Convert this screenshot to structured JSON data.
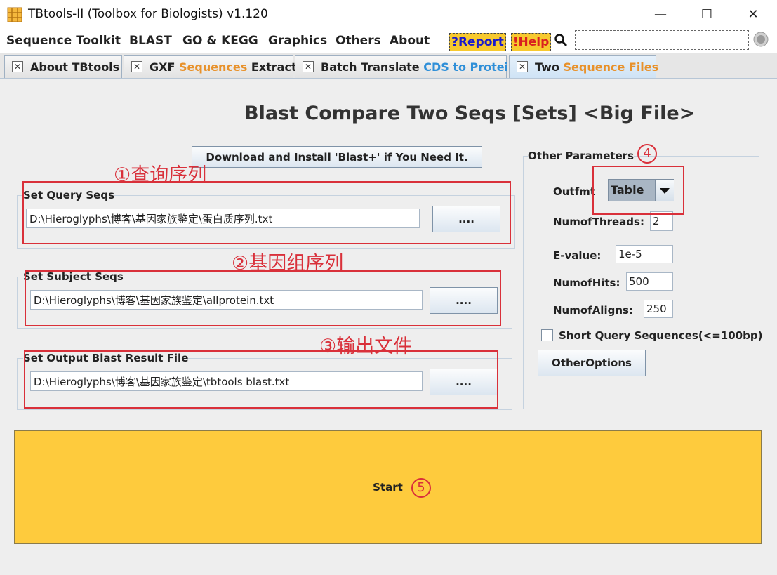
{
  "window": {
    "title": "TBtools-II (Toolbox for Biologists) v1.120",
    "minimize": "—",
    "maximize": "☐",
    "close": "✕"
  },
  "menu": {
    "items": [
      "Sequence Toolkit",
      "BLAST",
      "GO & KEGG",
      "Graphics",
      "Others",
      "About"
    ],
    "report": "?Report",
    "help": "!Help",
    "search_value": ""
  },
  "tabs": [
    {
      "label": "About TBtools"
    },
    {
      "label_parts": [
        "GXF",
        "Sequences",
        "Extract"
      ]
    },
    {
      "label_parts": [
        "Batch Translate",
        "CDS to Protein"
      ]
    },
    {
      "label_parts": [
        "Two",
        "Sequence Files"
      ]
    }
  ],
  "panel": {
    "title": "Blast Compare Two Seqs [Sets] <Big File>",
    "download_button": "Download and Install 'Blast+' if You Need It.",
    "query": {
      "label": "Set Query Seqs",
      "value": "D:\\Hieroglyphs\\博客\\基因家族鉴定\\蛋白质序列.txt",
      "browse": "...."
    },
    "subject": {
      "label": "Set Subject Seqs",
      "value": "D:\\Hieroglyphs\\博客\\基因家族鉴定\\allprotein.txt",
      "browse": "...."
    },
    "output": {
      "label": "Set Output Blast Result File",
      "value": "D:\\Hieroglyphs\\博客\\基因家族鉴定\\tbtools blast.txt",
      "browse": "...."
    },
    "params": {
      "title": "Other Parameters",
      "outfmt_label": "Outfmt",
      "outfmt_value": "Table",
      "threads_label": "NumofThreads:",
      "threads_value": "2",
      "evalue_label": "E-value:",
      "evalue_value": "1e-5",
      "hits_label": "NumofHits:",
      "hits_value": "500",
      "aligns_label": "NumofAligns:",
      "aligns_value": "250",
      "short_label": "Short Query Sequences(<=100bp)",
      "short_checked": false,
      "other_options": "OtherOptions"
    },
    "start_label": "Start"
  },
  "annotations": {
    "a1": "①查询序列",
    "a2": "②基因组序列",
    "a3": "③输出文件",
    "n4": "4",
    "n5": "5"
  },
  "colors": {
    "accent_orange": "#e8912a",
    "accent_blue": "#2f8fd8",
    "annotation_red": "#d9303a",
    "badge_yellow": "#f7c92e",
    "start_yellow": "#fecb3d"
  }
}
